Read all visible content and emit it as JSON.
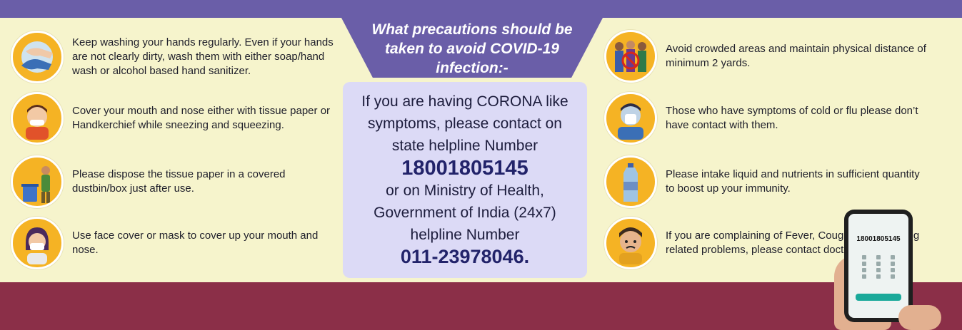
{
  "header": {
    "title": "What precautions should be taken to avoid COVID-19 infection:-"
  },
  "helpline": {
    "line1": "If you are having CORONA like",
    "line2": "symptoms, please contact on",
    "line3": "state helpline Number",
    "state_number": "18001805145",
    "line4": "or on Ministry of Health,",
    "line5": "Government of India (24x7)",
    "line6": "helpline Number",
    "central_number": "011-23978046."
  },
  "left_tips": [
    {
      "icon": "hand-washing-icon",
      "text": "Keep washing your hands regularly.  Even if your hands are not clearly dirty, wash them with either soap/hand wash or alcohol based hand sanitizer."
    },
    {
      "icon": "sneezing-person-icon",
      "text": "Cover your mouth and nose either with tissue paper or Handkerchief while sneezing and squeezing."
    },
    {
      "icon": "dustbin-disposal-icon",
      "text": "Please dispose the tissue paper in a covered dustbin/box just after use."
    },
    {
      "icon": "face-mask-icon",
      "text": "Use face cover or mask to cover up your mouth and nose."
    }
  ],
  "right_tips": [
    {
      "icon": "crowd-avoid-icon",
      "text": "Avoid crowded areas and maintain physical distance of minimum 2 yards."
    },
    {
      "icon": "cold-flu-person-icon",
      "text": "Those who have symptoms of cold or flu please don’t have contact with them."
    },
    {
      "icon": "water-bottle-icon",
      "text": "Please intake liquid and nutrients in sufficient quantity to boost up your immunity."
    },
    {
      "icon": "fever-person-icon",
      "text": "If you are complaining of Fever, Cough and Breathing related problems, please contact doctor."
    }
  ],
  "phone": {
    "display_number": "18001805145"
  },
  "colors": {
    "purple": "#6a5ea8",
    "maroon": "#8b2f48",
    "cream": "#f6f4cc",
    "icon_bg": "#f5b324",
    "panel_bg": "#dcdaf6"
  }
}
